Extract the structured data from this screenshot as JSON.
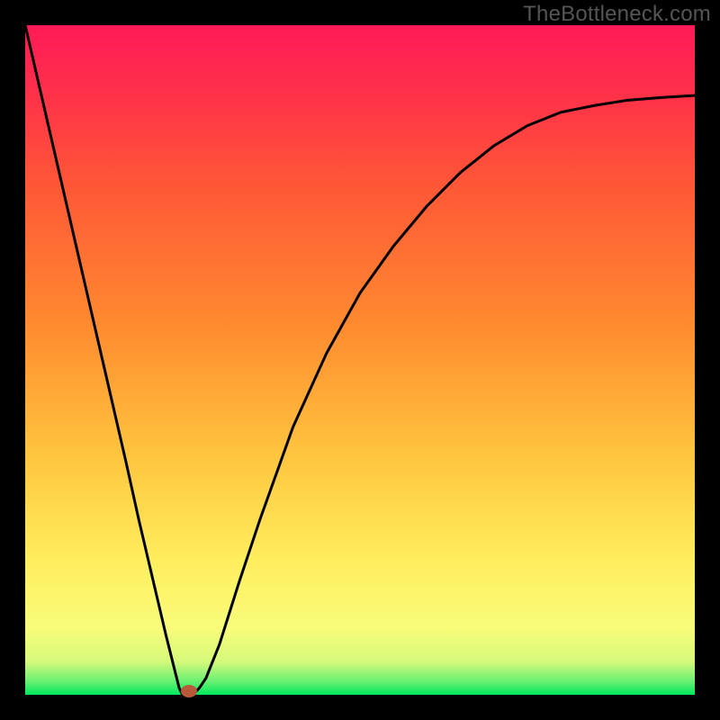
{
  "watermark": "TheBottleneck.com",
  "chart_data": {
    "type": "line",
    "title": "",
    "xlabel": "",
    "ylabel": "",
    "xlim": [
      0,
      1
    ],
    "ylim": [
      0,
      1
    ],
    "gradient_stops": [
      {
        "offset": 0.0,
        "color": "#00e85c"
      },
      {
        "offset": 0.02,
        "color": "#69ef72"
      },
      {
        "offset": 0.05,
        "color": "#d7f97b"
      },
      {
        "offset": 0.1,
        "color": "#f8fc79"
      },
      {
        "offset": 0.2,
        "color": "#ffee5e"
      },
      {
        "offset": 0.35,
        "color": "#ffc73f"
      },
      {
        "offset": 0.55,
        "color": "#ff8b2f"
      },
      {
        "offset": 0.75,
        "color": "#ff5a36"
      },
      {
        "offset": 0.9,
        "color": "#ff3049"
      },
      {
        "offset": 1.0,
        "color": "#ff1a57"
      }
    ],
    "curve": {
      "x": [
        0.0,
        0.03,
        0.06,
        0.09,
        0.12,
        0.15,
        0.17,
        0.19,
        0.21,
        0.23,
        0.235,
        0.24,
        0.25,
        0.26,
        0.27,
        0.29,
        0.32,
        0.35,
        0.4,
        0.45,
        0.5,
        0.55,
        0.6,
        0.65,
        0.7,
        0.75,
        0.8,
        0.85,
        0.9,
        0.95,
        1.0
      ],
      "y": [
        1.0,
        0.87,
        0.74,
        0.61,
        0.48,
        0.35,
        0.26,
        0.175,
        0.09,
        0.01,
        0.0,
        0.0,
        0.0,
        0.01,
        0.025,
        0.075,
        0.17,
        0.26,
        0.4,
        0.51,
        0.6,
        0.67,
        0.73,
        0.78,
        0.82,
        0.85,
        0.87,
        0.88,
        0.888,
        0.892,
        0.895
      ]
    },
    "marker": {
      "x": 0.245,
      "y": 0.006,
      "color": "#b85a3a"
    },
    "curve_color": "#000000",
    "curve_width": 3
  }
}
